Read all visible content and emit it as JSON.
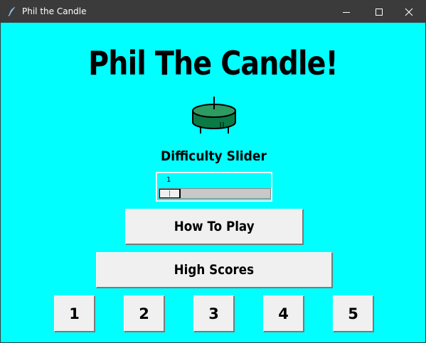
{
  "window": {
    "title": "Phil the Candle",
    "controls": [
      "minimize-icon",
      "maximize-icon",
      "close-icon"
    ]
  },
  "main": {
    "headline": "Phil The Candle!",
    "candle_icon": "candle-icon",
    "slider_label": "Difficulty Slider",
    "difficulty": {
      "value": "1",
      "level": 1
    },
    "buttons": {
      "how_to_play": "How To Play",
      "high_scores": "High Scores"
    },
    "level_buttons": [
      "1",
      "2",
      "3",
      "4",
      "5"
    ]
  },
  "colors": {
    "background": "#00ffff",
    "titlebar": "#3b3b3b",
    "button_face": "#f0f0f0",
    "candle_green": "#0b7a45",
    "text": "#000000"
  }
}
